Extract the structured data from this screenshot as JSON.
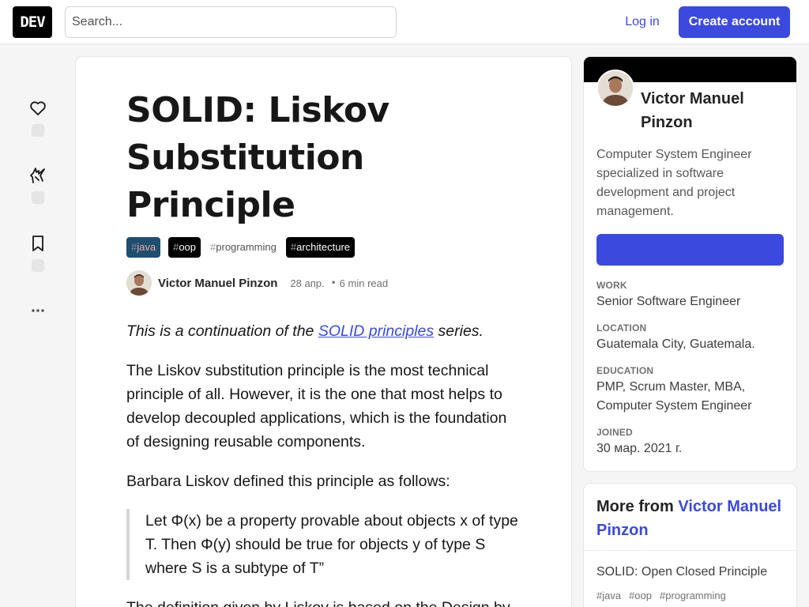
{
  "header": {
    "logo_text": "DEV",
    "search_placeholder": "Search...",
    "login_label": "Log in",
    "create_account_label": "Create account"
  },
  "reactions": {
    "items": [
      {
        "icon": "heart-icon"
      },
      {
        "icon": "unicorn-icon"
      },
      {
        "icon": "bookmark-icon"
      },
      {
        "icon": "more-horizontal-icon"
      }
    ]
  },
  "article": {
    "title": "SOLID: Liskov Substitution Principle",
    "tags": [
      {
        "hash": "#",
        "name": "java"
      },
      {
        "hash": "#",
        "name": "oop"
      },
      {
        "hash": "#",
        "name": "programming"
      },
      {
        "hash": "#",
        "name": "architecture"
      }
    ],
    "author": "Victor Manuel Pinzon",
    "date": "28 апр.",
    "separator": "•",
    "read_time": "6 min read",
    "intro_prefix": "This is a continuation of the ",
    "intro_link": "SOLID principles",
    "intro_suffix": " series.",
    "paragraph_1": "The Liskov substitution principle is the most technical principle of all. However, it is the one that most helps to develop decoupled applications, which is the foundation of designing reusable components.",
    "paragraph_2": "Barbara Liskov defined this principle as follows:",
    "quote": "Let Φ(x) be a property provable about objects x of type T. Then Φ(y) should be true for objects y of type S where S is a subtype of T”",
    "paragraph_3": "The definition given by Liskov is based on the Design by"
  },
  "profile": {
    "name": "Victor Manuel Pinzon",
    "bio": "Computer System Engineer specialized in software development and project management.",
    "follow_label": "",
    "work_label": "WORK",
    "work_value": "Senior Software Engineer",
    "location_label": "LOCATION",
    "location_value": "Guatemala City, Guatemala.",
    "education_label": "EDUCATION",
    "education_value": "PMP, Scrum Master, MBA, Computer System Engineer",
    "joined_label": "JOINED",
    "joined_value": "30 мар. 2021 г."
  },
  "more_from": {
    "prefix": "More from ",
    "author_link": "Victor Manuel Pinzon",
    "items": [
      {
        "title": "SOLID: Open Closed Principle",
        "tags": [
          "#java",
          "#oop",
          "#programming"
        ]
      }
    ]
  },
  "colors": {
    "accent": "#3b49df",
    "page_bg": "#f5f5f5",
    "tag_java_bg": "#1c4f70"
  }
}
